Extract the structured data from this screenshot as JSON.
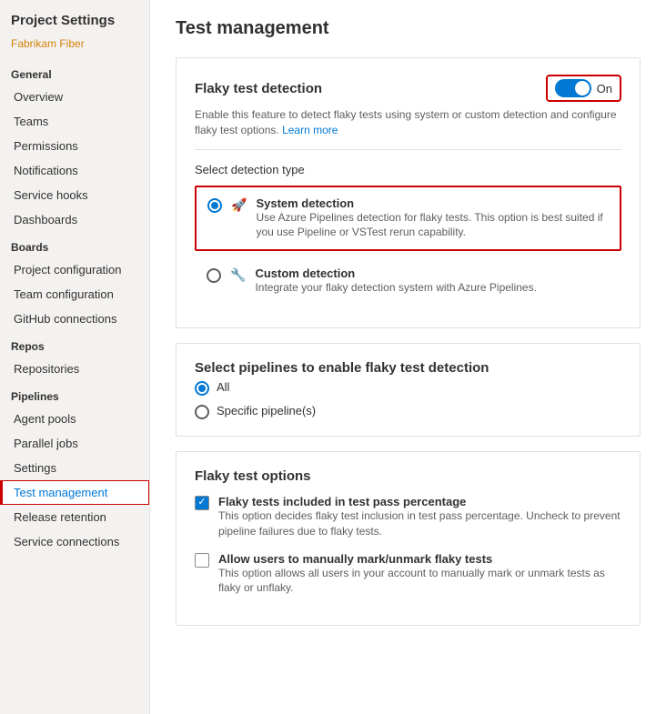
{
  "sidebar": {
    "title": "Project Settings",
    "brand": "Fabrikam Fiber",
    "general_header": "General",
    "items_general": [
      {
        "label": "Overview",
        "id": "overview"
      },
      {
        "label": "Teams",
        "id": "teams"
      },
      {
        "label": "Permissions",
        "id": "permissions"
      },
      {
        "label": "Notifications",
        "id": "notifications"
      },
      {
        "label": "Service hooks",
        "id": "service-hooks"
      },
      {
        "label": "Dashboards",
        "id": "dashboards"
      }
    ],
    "boards_header": "Boards",
    "items_boards": [
      {
        "label": "Project configuration",
        "id": "project-configuration"
      },
      {
        "label": "Team configuration",
        "id": "team-configuration"
      },
      {
        "label": "GitHub connections",
        "id": "github-connections"
      }
    ],
    "repos_header": "Repos",
    "items_repos": [
      {
        "label": "Repositories",
        "id": "repositories"
      }
    ],
    "pipelines_header": "Pipelines",
    "items_pipelines": [
      {
        "label": "Agent pools",
        "id": "agent-pools"
      },
      {
        "label": "Parallel jobs",
        "id": "parallel-jobs"
      },
      {
        "label": "Settings",
        "id": "settings"
      },
      {
        "label": "Test management",
        "id": "test-management",
        "active": true
      },
      {
        "label": "Release retention",
        "id": "release-retention"
      },
      {
        "label": "Service connections",
        "id": "service-connections"
      }
    ]
  },
  "main": {
    "page_title": "Test management",
    "flaky_detection": {
      "card_title": "Flaky test detection",
      "toggle_label": "On",
      "toggle_on": true,
      "description": "Enable this feature to detect flaky tests using system or custom detection and configure flaky test options.",
      "learn_more": "Learn more",
      "detection_type_label": "Select detection type",
      "options": [
        {
          "id": "system",
          "title": "System detection",
          "description": "Use Azure Pipelines detection for flaky tests. This option is best suited if you use Pipeline or VSTest rerun capability.",
          "selected": true,
          "icon": "🚀"
        },
        {
          "id": "custom",
          "title": "Custom detection",
          "description": "Integrate your flaky detection system with Azure Pipelines.",
          "selected": false,
          "icon": "🔧"
        }
      ]
    },
    "pipelines_section": {
      "card_title": "Select pipelines to enable flaky test detection",
      "options": [
        {
          "id": "all",
          "label": "All",
          "selected": true
        },
        {
          "id": "specific",
          "label": "Specific pipeline(s)",
          "selected": false
        }
      ]
    },
    "flaky_options": {
      "card_title": "Flaky test options",
      "checkboxes": [
        {
          "id": "include-pass",
          "title": "Flaky tests included in test pass percentage",
          "description": "This option decides flaky test inclusion in test pass percentage. Uncheck to prevent pipeline failures due to flaky tests.",
          "checked": true
        },
        {
          "id": "manual-mark",
          "title": "Allow users to manually mark/unmark flaky tests",
          "description": "This option allows all users in your account to manually mark or unmark tests as flaky or unflaky.",
          "checked": false
        }
      ]
    }
  }
}
